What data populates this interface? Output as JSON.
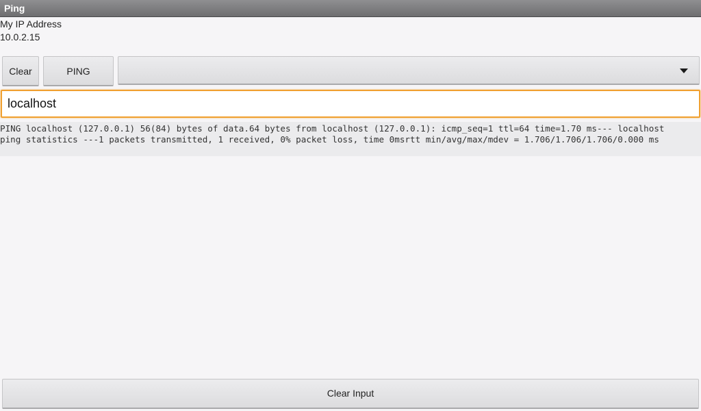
{
  "window": {
    "title": "Ping"
  },
  "ip_info": {
    "label": "My IP Address",
    "value": "10.0.2.15"
  },
  "toolbar": {
    "clear_label": "Clear",
    "ping_label": "PING",
    "spinner_value": ""
  },
  "host_input": {
    "value": "localhost"
  },
  "output": {
    "line1": "PING localhost (127.0.0.1) 56(84) bytes of data.64 bytes from localhost (127.0.0.1): icmp_seq=1 ttl=64 time=1.70 ms--- localhost",
    "line2": "ping statistics ---1 packets transmitted, 1 received, 0% packet loss, time 0msrtt min/avg/max/mdev = 1.706/1.706/1.706/0.000 ms"
  },
  "footer": {
    "clear_input_label": "Clear Input"
  }
}
